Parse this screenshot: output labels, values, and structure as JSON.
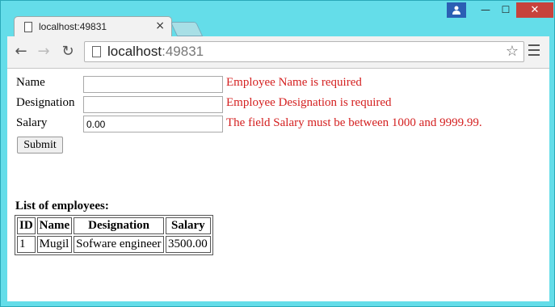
{
  "browser": {
    "tab_title": "localhost:49831",
    "tab_close": "×",
    "url_host": "localhost",
    "url_port": ":49831",
    "window_min": "—",
    "window_max": "☐",
    "window_close": "✕"
  },
  "form": {
    "name_label": "Name",
    "name_value": "",
    "name_error": "Employee Name is required",
    "designation_label": "Designation",
    "designation_value": "",
    "designation_error": "Employee Designation is required",
    "salary_label": "Salary",
    "salary_value": "0.00",
    "salary_error": "The field Salary must be between 1000 and 9999.99.",
    "submit_label": "Submit"
  },
  "employees": {
    "title": "List of employees:",
    "columns": [
      "ID",
      "Name",
      "Designation",
      "Salary"
    ],
    "rows": [
      [
        "1",
        "Mugil",
        "Sofware engineer",
        "3500.00"
      ]
    ]
  },
  "colors": {
    "error": "#d42020",
    "accent_frame": "#64dde9",
    "close_button": "#c7423c"
  }
}
